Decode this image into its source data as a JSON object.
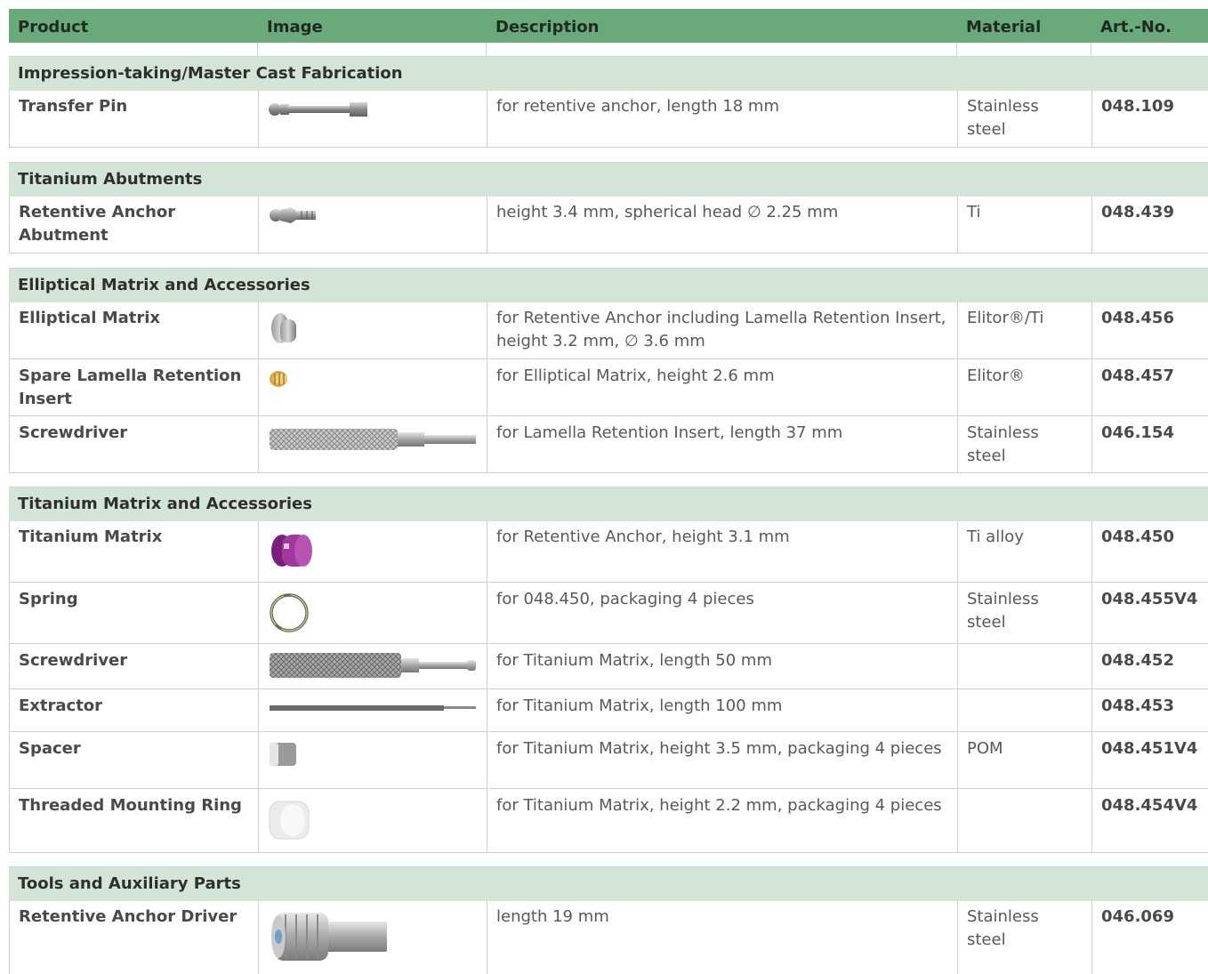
{
  "header": {
    "product": "Product",
    "image": "Image",
    "description": "Description",
    "material": "Material",
    "art_no": "Art.-No."
  },
  "sections": [
    {
      "title": "Impression-taking/Master Cast Fabrication",
      "rows": [
        {
          "product": "Transfer Pin",
          "image_icon": "transfer-pin-icon",
          "description": "for retentive anchor, length 18 mm",
          "material": "Stainless steel",
          "art_no": "048.109"
        }
      ]
    },
    {
      "title": "Titanium Abutments",
      "rows": [
        {
          "product": "Retentive Anchor Abutment",
          "image_icon": "abutment-icon",
          "description": "height 3.4 mm, spherical head ∅ 2.25 mm",
          "material": "Ti",
          "art_no": "048.439"
        }
      ]
    },
    {
      "title": "Elliptical Matrix and Accessories",
      "rows": [
        {
          "product": "Elliptical Matrix",
          "image_icon": "elliptical-matrix-icon",
          "description": "for Retentive Anchor including Lamella Retention Insert, height 3.2 mm, ∅ 3.6 mm",
          "material": "Elitor®/Ti",
          "art_no": "048.456"
        },
        {
          "product": "Spare Lamella Retention Insert",
          "image_icon": "lamella-insert-icon",
          "description": "for Elliptical Matrix, height 2.6 mm",
          "material": "Elitor®",
          "art_no": "048.457"
        },
        {
          "product": "Screwdriver",
          "image_icon": "screwdriver-icon",
          "description": "for Lamella Retention Insert, length 37 mm",
          "material": "Stainless steel",
          "art_no": "046.154"
        }
      ]
    },
    {
      "title": "Titanium Matrix and Accessories",
      "rows": [
        {
          "product": "Titanium Matrix",
          "image_icon": "titanium-matrix-icon",
          "description": "for Retentive Anchor, height 3.1 mm",
          "material": "Ti alloy",
          "art_no": "048.450"
        },
        {
          "product": "Spring",
          "image_icon": "spring-icon",
          "description": "for 048.450, packaging 4 pieces",
          "material": "Stainless steel",
          "art_no": "048.455V4"
        },
        {
          "product": "Screwdriver",
          "image_icon": "screwdriver-icon",
          "description": "for Titanium Matrix, length 50 mm",
          "material": "",
          "art_no": "048.452"
        },
        {
          "product": "Extractor",
          "image_icon": "extractor-icon",
          "description": "for Titanium Matrix, length 100 mm",
          "material": "",
          "art_no": "048.453"
        },
        {
          "product": "Spacer",
          "image_icon": "spacer-icon",
          "description": "for Titanium Matrix, height 3.5 mm, packaging 4 pieces",
          "material": "POM",
          "art_no": "048.451V4"
        },
        {
          "product": "Threaded Mounting Ring",
          "image_icon": "mounting-ring-icon",
          "description": "for Titanium Matrix, height 2.2 mm, packaging 4 pieces",
          "material": "",
          "art_no": "048.454V4"
        }
      ]
    },
    {
      "title": "Tools and Auxiliary Parts",
      "rows": [
        {
          "product": "Retentive Anchor Driver",
          "image_icon": "driver-icon",
          "description": "length 19 mm",
          "material": "Stainless steel",
          "art_no": "046.069"
        }
      ]
    }
  ],
  "colors": {
    "header_bg": "#6aa97a",
    "section_bg": "#d3e5d6",
    "titanium_matrix": "#8e2a8c"
  }
}
